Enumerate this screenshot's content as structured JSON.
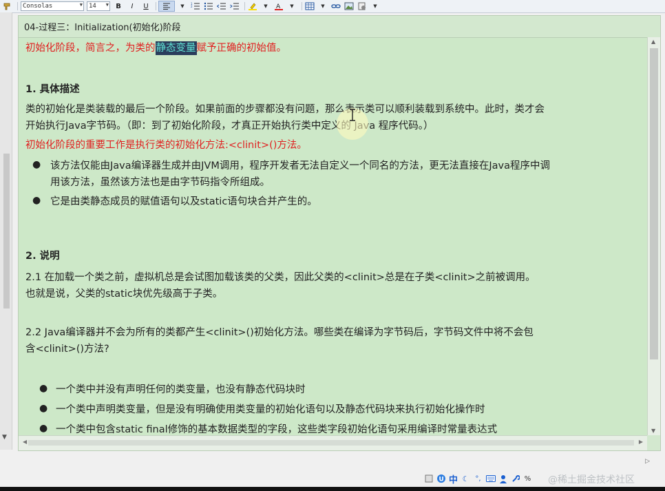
{
  "toolbar": {
    "font_name": "Consolas",
    "font_size": "14",
    "bold": "B",
    "italic": "I",
    "underline": "U"
  },
  "note": {
    "title": "04-过程三：Initialization(初始化)阶段",
    "intro_before": "初始化阶段，简言之，为类的",
    "intro_highlight": "静态变量",
    "intro_after": "赋予正确的初始值。",
    "sec1_heading": "1. 具体描述",
    "sec1_line1": "类的初始化是类装载的最后一个阶段。如果前面的步骤都没有问题，那么表示类可以顺利装载到系统中。此时，类才会",
    "sec1_line2": "开始执行Java字节码。（即：到了初始化阶段，才真正开始执行类中定义的 Java 程序代码。）",
    "sec1_red": "初始化阶段的重要工作是执行类的初始化方法:<clinit>()方法。",
    "sec1_bullet1_line1": "该方法仅能由Java编译器生成并由JVM调用，程序开发者无法自定义一个同名的方法，更无法直接在Java程序中调",
    "sec1_bullet1_line2": "用该方法，虽然该方法也是由字节码指令所组成。",
    "sec1_bullet2": "它是由类静态成员的赋值语句以及static语句块合并产生的。",
    "sec2_heading": "2. 说明",
    "sec2_p1_line1": "2.1 在加载一个类之前，虚拟机总是会试图加载该类的父类，因此父类的<clinit>总是在子类<clinit>之前被调用。",
    "sec2_p1_line2": "也就是说，父类的static块优先级高于子类。",
    "sec2_p2_line1": "2.2 Java编译器并不会为所有的类都产生<clinit>()初始化方法。哪些类在编译为字节码后，字节码文件中将不会包",
    "sec2_p2_line2": "含<clinit>()方法?",
    "sec2_bullets": [
      "一个类中并没有声明任何的类变量，也没有静态代码块时",
      "一个类中声明类变量，但是没有明确使用类变量的初始化语句以及静态代码块来执行初始化操作时",
      "一个类中包含static final修饰的基本数据类型的字段，这些类字段初始化语句采用编译时常量表达式"
    ]
  },
  "taskbar": {
    "ime_lang": "中",
    "percent": "%",
    "watermark": "@稀土掘金技术社区"
  }
}
